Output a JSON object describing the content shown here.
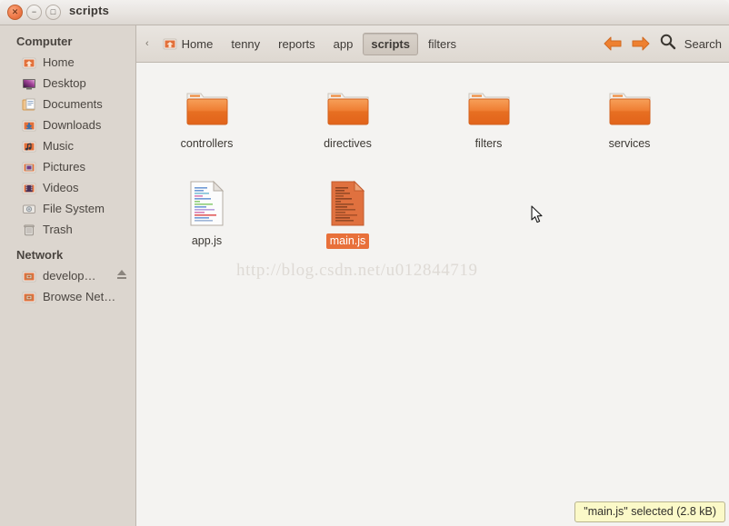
{
  "window": {
    "title": "scripts",
    "buttons": {
      "close": "close-button",
      "minimize": "minimize-button",
      "maximize": "maximize-button"
    }
  },
  "sidebar": {
    "sections": [
      {
        "heading": "Computer",
        "items": [
          {
            "label": "Home",
            "icon": "home-folder-icon"
          },
          {
            "label": "Desktop",
            "icon": "desktop-monitor-icon"
          },
          {
            "label": "Documents",
            "icon": "documents-folder-icon"
          },
          {
            "label": "Downloads",
            "icon": "downloads-folder-icon"
          },
          {
            "label": "Music",
            "icon": "music-folder-icon"
          },
          {
            "label": "Pictures",
            "icon": "pictures-folder-icon"
          },
          {
            "label": "Videos",
            "icon": "videos-folder-icon"
          },
          {
            "label": "File System",
            "icon": "drive-icon"
          },
          {
            "label": "Trash",
            "icon": "trash-icon"
          }
        ]
      },
      {
        "heading": "Network",
        "items": [
          {
            "label": "develop…",
            "icon": "network-share-icon",
            "eject": true
          },
          {
            "label": "Browse Net…",
            "icon": "network-browse-icon",
            "eject": false
          }
        ]
      }
    ]
  },
  "pathbar": {
    "overflow_indicator": "‹",
    "crumbs": [
      {
        "label": "Home",
        "icon": "home-folder-icon",
        "active": false
      },
      {
        "label": "tenny",
        "icon": "",
        "active": false
      },
      {
        "label": "reports",
        "icon": "",
        "active": false
      },
      {
        "label": "app",
        "icon": "",
        "active": false
      },
      {
        "label": "scripts",
        "icon": "",
        "active": true
      },
      {
        "label": "filters",
        "icon": "",
        "active": false
      }
    ],
    "back_icon": "back-arrow-icon",
    "forward_icon": "forward-arrow-icon",
    "search_icon": "search-icon",
    "search_label": "Search"
  },
  "content": {
    "rows": [
      [
        {
          "name": "controllers",
          "type": "folder",
          "selected": false
        },
        {
          "name": "directives",
          "type": "folder",
          "selected": false
        },
        {
          "name": "filters",
          "type": "folder",
          "selected": false
        },
        {
          "name": "services",
          "type": "folder",
          "selected": false
        }
      ],
      [
        {
          "name": "app.js",
          "type": "file-js",
          "selected": false
        },
        {
          "name": "main.js",
          "type": "file-js-selected",
          "selected": true
        }
      ]
    ],
    "watermark": "http://blog.csdn.net/u012844719"
  },
  "status": {
    "text": "\"main.js\" selected (2.8 kB)"
  },
  "colors": {
    "accent_orange": "#e8703a",
    "selection_orange": "#e8703a",
    "sidebar_bg": "#dcd6cf",
    "content_bg": "#f4f3f1",
    "titlebar_bg": "#e8e4e0",
    "status_bg": "#fbf9c8"
  }
}
